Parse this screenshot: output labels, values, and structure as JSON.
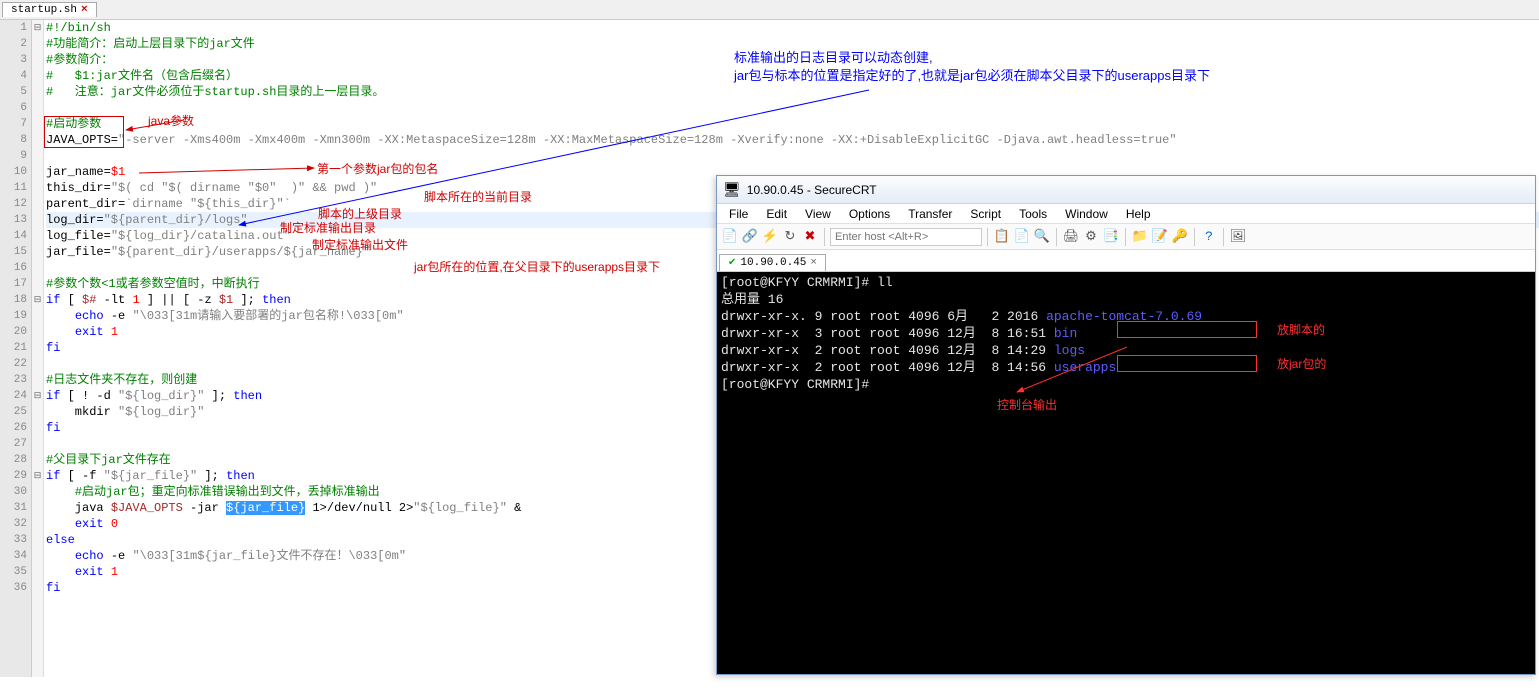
{
  "tab": {
    "name": "startup.sh",
    "close": "×"
  },
  "code_lines": [
    {
      "n": 1,
      "fold": "⊟",
      "segs": [
        {
          "c": "cmt",
          "t": "#!/bin/sh"
        }
      ]
    },
    {
      "n": 2,
      "fold": "",
      "segs": [
        {
          "c": "cmt",
          "t": "#功能简介：启动上层目录下的jar文件"
        }
      ]
    },
    {
      "n": 3,
      "fold": "",
      "segs": [
        {
          "c": "cmt",
          "t": "#参数简介："
        }
      ]
    },
    {
      "n": 4,
      "fold": "",
      "segs": [
        {
          "c": "cmt",
          "t": "#   $1:jar文件名（包含后缀名）"
        }
      ]
    },
    {
      "n": 5,
      "fold": "",
      "segs": [
        {
          "c": "cmt",
          "t": "#   注意：jar文件必须位于startup.sh目录的上一层目录。"
        }
      ]
    },
    {
      "n": 6,
      "fold": "",
      "segs": [
        {
          "c": "",
          "t": ""
        }
      ]
    },
    {
      "n": 7,
      "fold": "",
      "segs": [
        {
          "c": "cmt",
          "t": "#启动参数"
        }
      ]
    },
    {
      "n": 8,
      "fold": "",
      "segs": [
        {
          "c": "op",
          "t": "JAVA_OPTS="
        },
        {
          "c": "str",
          "t": "\"-server -Xms400m -Xmx400m -Xmn300m -XX:MetaspaceSize=128m -XX:MaxMetaspaceSize=128m -Xverify:none -XX:+DisableExplicitGC -Djava.awt.headless=true\""
        }
      ]
    },
    {
      "n": 9,
      "fold": "",
      "segs": [
        {
          "c": "",
          "t": ""
        }
      ]
    },
    {
      "n": 10,
      "fold": "",
      "segs": [
        {
          "c": "op",
          "t": "jar_name="
        },
        {
          "c": "num",
          "t": "$1"
        }
      ]
    },
    {
      "n": 11,
      "fold": "",
      "segs": [
        {
          "c": "op",
          "t": "this_dir="
        },
        {
          "c": "str",
          "t": "\"$( cd \"$( dirname \"$0\"  )\" && pwd )\""
        }
      ]
    },
    {
      "n": 12,
      "fold": "",
      "segs": [
        {
          "c": "op",
          "t": "parent_dir="
        },
        {
          "c": "str",
          "t": "`dirname \"${this_dir}\"`"
        }
      ]
    },
    {
      "n": 13,
      "fold": "",
      "hl": true,
      "segs": [
        {
          "c": "op",
          "t": "log_dir="
        },
        {
          "c": "str",
          "t": "\"${parent_dir}/logs\""
        }
      ]
    },
    {
      "n": 14,
      "fold": "",
      "segs": [
        {
          "c": "op",
          "t": "log_file="
        },
        {
          "c": "str",
          "t": "\"${log_dir}/catalina.out\""
        }
      ]
    },
    {
      "n": 15,
      "fold": "",
      "segs": [
        {
          "c": "op",
          "t": "jar_file="
        },
        {
          "c": "str",
          "t": "\"${parent_dir}/userapps/${jar_name}\""
        }
      ]
    },
    {
      "n": 16,
      "fold": "",
      "segs": [
        {
          "c": "",
          "t": ""
        }
      ]
    },
    {
      "n": 17,
      "fold": "",
      "segs": [
        {
          "c": "cmt",
          "t": "#参数个数<1或者参数空值时，中断执行"
        }
      ]
    },
    {
      "n": 18,
      "fold": "⊟",
      "segs": [
        {
          "c": "kw",
          "t": "if"
        },
        {
          "c": "op",
          "t": " [ "
        },
        {
          "c": "var",
          "t": "$#"
        },
        {
          "c": "op",
          "t": " -lt "
        },
        {
          "c": "num",
          "t": "1"
        },
        {
          "c": "op",
          "t": " ] || [ -z "
        },
        {
          "c": "var",
          "t": "$1"
        },
        {
          "c": "op",
          "t": " ]; "
        },
        {
          "c": "kw",
          "t": "then"
        }
      ]
    },
    {
      "n": 19,
      "fold": "",
      "segs": [
        {
          "c": "op",
          "t": "    "
        },
        {
          "c": "kw",
          "t": "echo"
        },
        {
          "c": "op",
          "t": " -e "
        },
        {
          "c": "str",
          "t": "\"\\033[31m请输入要部署的jar包名称!\\033[0m\""
        }
      ]
    },
    {
      "n": 20,
      "fold": "",
      "segs": [
        {
          "c": "op",
          "t": "    "
        },
        {
          "c": "kw",
          "t": "exit"
        },
        {
          "c": "op",
          "t": " "
        },
        {
          "c": "num",
          "t": "1"
        }
      ]
    },
    {
      "n": 21,
      "fold": "",
      "segs": [
        {
          "c": "kw",
          "t": "fi"
        }
      ]
    },
    {
      "n": 22,
      "fold": "",
      "segs": [
        {
          "c": "",
          "t": ""
        }
      ]
    },
    {
      "n": 23,
      "fold": "",
      "segs": [
        {
          "c": "cmt",
          "t": "#日志文件夹不存在，则创建"
        }
      ]
    },
    {
      "n": 24,
      "fold": "⊟",
      "segs": [
        {
          "c": "kw",
          "t": "if"
        },
        {
          "c": "op",
          "t": " [ ! -d "
        },
        {
          "c": "str",
          "t": "\"${log_dir}\""
        },
        {
          "c": "op",
          "t": " ]; "
        },
        {
          "c": "kw",
          "t": "then"
        }
      ]
    },
    {
      "n": 25,
      "fold": "",
      "segs": [
        {
          "c": "op",
          "t": "    mkdir "
        },
        {
          "c": "str",
          "t": "\"${log_dir}\""
        }
      ]
    },
    {
      "n": 26,
      "fold": "",
      "segs": [
        {
          "c": "kw",
          "t": "fi"
        }
      ]
    },
    {
      "n": 27,
      "fold": "",
      "segs": [
        {
          "c": "",
          "t": ""
        }
      ]
    },
    {
      "n": 28,
      "fold": "",
      "segs": [
        {
          "c": "cmt",
          "t": "#父目录下jar文件存在"
        }
      ]
    },
    {
      "n": 29,
      "fold": "⊟",
      "segs": [
        {
          "c": "kw",
          "t": "if"
        },
        {
          "c": "op",
          "t": " [ -f "
        },
        {
          "c": "str",
          "t": "\"${jar_file}\""
        },
        {
          "c": "op",
          "t": " ]; "
        },
        {
          "c": "kw",
          "t": "then"
        }
      ]
    },
    {
      "n": 30,
      "fold": "",
      "segs": [
        {
          "c": "op",
          "t": "    "
        },
        {
          "c": "cmt",
          "t": "#启动jar包；重定向标准错误输出到文件，丢掉标准输出"
        }
      ]
    },
    {
      "n": 31,
      "fold": "",
      "segs": [
        {
          "c": "op",
          "t": "    java "
        },
        {
          "c": "var",
          "t": "$JAVA_OPTS"
        },
        {
          "c": "op",
          "t": " -jar "
        },
        {
          "c": "sel",
          "t": "${jar_file}"
        },
        {
          "c": "op",
          "t": " 1>/dev/null 2>"
        },
        {
          "c": "str",
          "t": "\"${log_file}\""
        },
        {
          "c": "op",
          "t": " &"
        }
      ]
    },
    {
      "n": 32,
      "fold": "",
      "segs": [
        {
          "c": "op",
          "t": "    "
        },
        {
          "c": "kw",
          "t": "exit"
        },
        {
          "c": "op",
          "t": " "
        },
        {
          "c": "num",
          "t": "0"
        }
      ]
    },
    {
      "n": 33,
      "fold": "",
      "segs": [
        {
          "c": "kw",
          "t": "else"
        }
      ]
    },
    {
      "n": 34,
      "fold": "",
      "segs": [
        {
          "c": "op",
          "t": "    "
        },
        {
          "c": "kw",
          "t": "echo"
        },
        {
          "c": "op",
          "t": " -e "
        },
        {
          "c": "str",
          "t": "\"\\033[31m${jar_file}文件不存在！\\033[0m\""
        }
      ]
    },
    {
      "n": 35,
      "fold": "",
      "segs": [
        {
          "c": "op",
          "t": "    "
        },
        {
          "c": "kw",
          "t": "exit"
        },
        {
          "c": "op",
          "t": " "
        },
        {
          "c": "num",
          "t": "1"
        }
      ]
    },
    {
      "n": 36,
      "fold": "",
      "segs": [
        {
          "c": "kw",
          "t": "fi"
        }
      ]
    }
  ],
  "annotations": {
    "blue1": "标准输出的日志目录可以动态创建,",
    "blue2": "jar包与标本的位置是指定好的了,也就是jar包必须在脚本父目录下的userapps目录下",
    "red_java": "java参数",
    "red_jarname": "第一个参数jar包的包名",
    "red_thisdir": "脚本所在的当前目录",
    "red_parentdir": "脚本的上级目录",
    "red_logdir": "制定标准输出目录",
    "red_logfile": "制定标准输出文件",
    "red_jarfile": "jar包所在的位置,在父目录下的userapps目录下"
  },
  "crt": {
    "title": "10.90.0.45 - SecureCRT",
    "menu": [
      "File",
      "Edit",
      "View",
      "Options",
      "Transfer",
      "Script",
      "Tools",
      "Window",
      "Help"
    ],
    "host_placeholder": "Enter host <Alt+R>",
    "tab": "10.90.0.45",
    "tab_close": "×",
    "terminal": [
      {
        "segs": [
          {
            "c": "t-white",
            "t": "[root@KFYY CRMRMI]# ll"
          }
        ]
      },
      {
        "segs": [
          {
            "c": "t-white",
            "t": "总用量 16"
          }
        ]
      },
      {
        "segs": [
          {
            "c": "t-white",
            "t": "drwxr-xr-x. 9 root root 4096 6月   2 2016 "
          },
          {
            "c": "t-blue",
            "t": "apache-tomcat-7.0.69"
          }
        ]
      },
      {
        "segs": [
          {
            "c": "t-white",
            "t": "drwxr-xr-x  3 root root 4096 12月  8 16:51 "
          },
          {
            "c": "t-blue",
            "t": "bin"
          }
        ]
      },
      {
        "segs": [
          {
            "c": "t-white",
            "t": "drwxr-xr-x  2 root root 4096 12月  8 14:29 "
          },
          {
            "c": "t-blue",
            "t": "logs"
          }
        ]
      },
      {
        "segs": [
          {
            "c": "t-white",
            "t": "drwxr-xr-x  2 root root 4096 12月  8 14:56 "
          },
          {
            "c": "t-blue",
            "t": "userapps"
          }
        ]
      },
      {
        "segs": [
          {
            "c": "t-white",
            "t": "[root@KFYY CRMRMI]#"
          }
        ]
      }
    ],
    "term_anno": {
      "bin": "放脚本的",
      "userapps": "放jar包的",
      "console": "控制台输出"
    }
  }
}
